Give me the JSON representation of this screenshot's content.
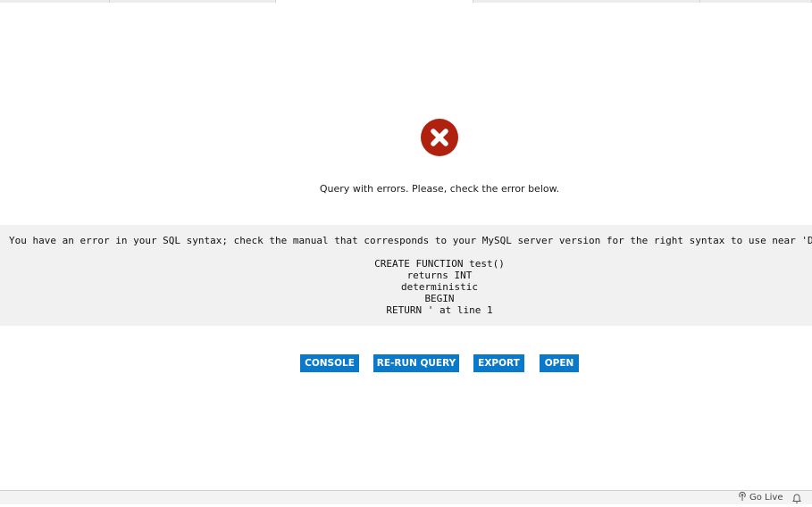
{
  "result": {
    "message": "Query with errors. Please, check the error below.",
    "error_first_line": "You have an error in your SQL syntax; check the manual that corresponds to your MySQL server version for the right syntax to use near 'DELIMITER $$",
    "error_code_lines": [
      "CREATE FUNCTION test()",
      "returns INT",
      "deterministic",
      "BEGIN",
      "RETURN ' at line 1"
    ],
    "status_icon": "error-x-circle-icon",
    "error_color": "#b0210f"
  },
  "actions": {
    "console": "CONSOLE",
    "rerun": "RE-RUN QUERY",
    "export": "EXPORT",
    "open": "OPEN",
    "color": "#0a79c9"
  },
  "statusbar": {
    "go_live": "Go Live",
    "go_live_icon": "broadcast-icon",
    "notifications_icon": "bell-icon"
  }
}
